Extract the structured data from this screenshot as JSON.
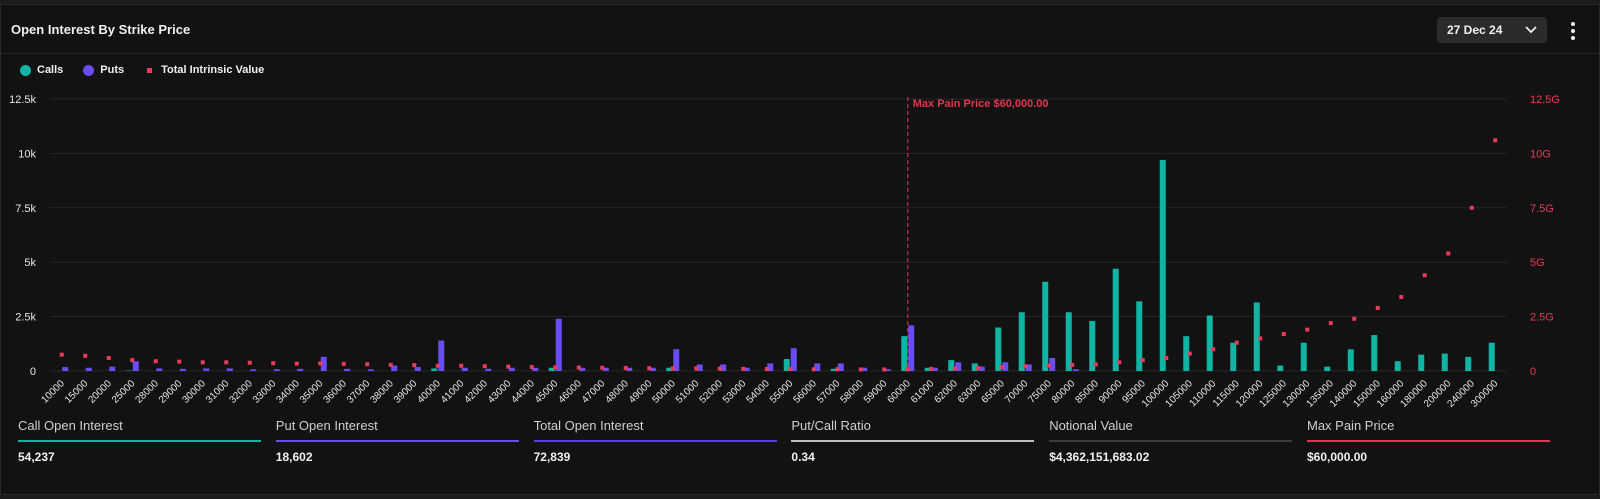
{
  "header": {
    "title": "Open Interest By Strike Price",
    "date_value": "27 Dec 24"
  },
  "legend": {
    "calls": "Calls",
    "puts": "Puts",
    "intrinsic": "Total Intrinsic Value"
  },
  "colors": {
    "calls": "#0fb5a2",
    "puts": "#6a4cf3",
    "intrinsic": "#ea3b59",
    "total": "#5b3de0",
    "ratio": "#bdbdbd",
    "notional": "#3a3a3a",
    "maxpain": "#e3354f"
  },
  "chart_data": {
    "type": "bar",
    "categories": [
      "10000",
      "15000",
      "20000",
      "25000",
      "28000",
      "29000",
      "30000",
      "31000",
      "32000",
      "33000",
      "34000",
      "35000",
      "36000",
      "37000",
      "38000",
      "39000",
      "40000",
      "41000",
      "42000",
      "43000",
      "44000",
      "45000",
      "46000",
      "47000",
      "48000",
      "49000",
      "50000",
      "51000",
      "52000",
      "53000",
      "54000",
      "55000",
      "56000",
      "57000",
      "58000",
      "59000",
      "60000",
      "61000",
      "62000",
      "63000",
      "65000",
      "70000",
      "75000",
      "80000",
      "85000",
      "90000",
      "95000",
      "100000",
      "105000",
      "110000",
      "115000",
      "120000",
      "125000",
      "130000",
      "135000",
      "140000",
      "150000",
      "160000",
      "180000",
      "200000",
      "240000",
      "300000"
    ],
    "series": [
      {
        "name": "Calls",
        "values": [
          0,
          0,
          0,
          20,
          0,
          0,
          0,
          0,
          0,
          0,
          0,
          0,
          0,
          0,
          0,
          0,
          120,
          0,
          0,
          0,
          0,
          150,
          0,
          0,
          0,
          0,
          150,
          0,
          0,
          0,
          0,
          550,
          0,
          100,
          0,
          0,
          1600,
          150,
          500,
          350,
          2000,
          2700,
          4100,
          2700,
          2300,
          4700,
          3200,
          9700,
          1600,
          2550,
          1300,
          3150,
          250,
          1300,
          200,
          1000,
          1650,
          450,
          750,
          800,
          650,
          1300
        ]
      },
      {
        "name": "Puts",
        "values": [
          180,
          150,
          200,
          450,
          120,
          100,
          120,
          120,
          80,
          80,
          100,
          650,
          100,
          80,
          250,
          180,
          1400,
          150,
          100,
          150,
          150,
          2400,
          150,
          150,
          150,
          150,
          1000,
          300,
          300,
          150,
          350,
          1050,
          350,
          350,
          150,
          80,
          2100,
          150,
          400,
          200,
          400,
          300,
          600,
          80,
          0,
          0,
          0,
          0,
          0,
          0,
          0,
          0,
          0,
          0,
          0,
          0,
          0,
          0,
          0,
          0,
          0,
          0
        ]
      },
      {
        "name": "Total Intrinsic Value",
        "values": [
          0.75,
          0.7,
          0.6,
          0.5,
          0.45,
          0.43,
          0.4,
          0.4,
          0.38,
          0.36,
          0.34,
          0.35,
          0.33,
          0.31,
          0.28,
          0.27,
          0.24,
          0.24,
          0.22,
          0.2,
          0.18,
          0.17,
          0.16,
          0.15,
          0.14,
          0.13,
          0.12,
          0.12,
          0.11,
          0.1,
          0.09,
          0.09,
          0.08,
          0.08,
          0.07,
          0.07,
          0.07,
          0.1,
          0.12,
          0.14,
          0.18,
          0.22,
          0.25,
          0.28,
          0.3,
          0.4,
          0.5,
          0.6,
          0.8,
          1.0,
          1.3,
          1.5,
          1.7,
          1.9,
          2.2,
          2.4,
          2.9,
          3.4,
          4.4,
          5.4,
          7.5,
          10.6
        ]
      }
    ],
    "yticks_left": [
      "12.5k",
      "10k",
      "7.5k",
      "5k",
      "2.5k",
      "0"
    ],
    "yticks_right": [
      "12.5G",
      "10G",
      "7.5G",
      "5G",
      "2.5G",
      "0"
    ],
    "ylim": [
      0,
      12500
    ],
    "ylim_right": [
      0,
      12.5
    ],
    "max_pain_strike": "60000",
    "max_pain_label": "Max Pain Price $60,000.00",
    "legend_position": "top-left",
    "grid": true
  },
  "stats": [
    {
      "label": "Call Open Interest",
      "value": "54,237",
      "color_key": "calls"
    },
    {
      "label": "Put Open Interest",
      "value": "18,602",
      "color_key": "puts"
    },
    {
      "label": "Total Open Interest",
      "value": "72,839",
      "color_key": "total"
    },
    {
      "label": "Put/Call Ratio",
      "value": "0.34",
      "color_key": "ratio"
    },
    {
      "label": "Notional Value",
      "value": "$4,362,151,683.02",
      "color_key": "notional"
    },
    {
      "label": "Max Pain Price",
      "value": "$60,000.00",
      "color_key": "maxpain"
    }
  ]
}
